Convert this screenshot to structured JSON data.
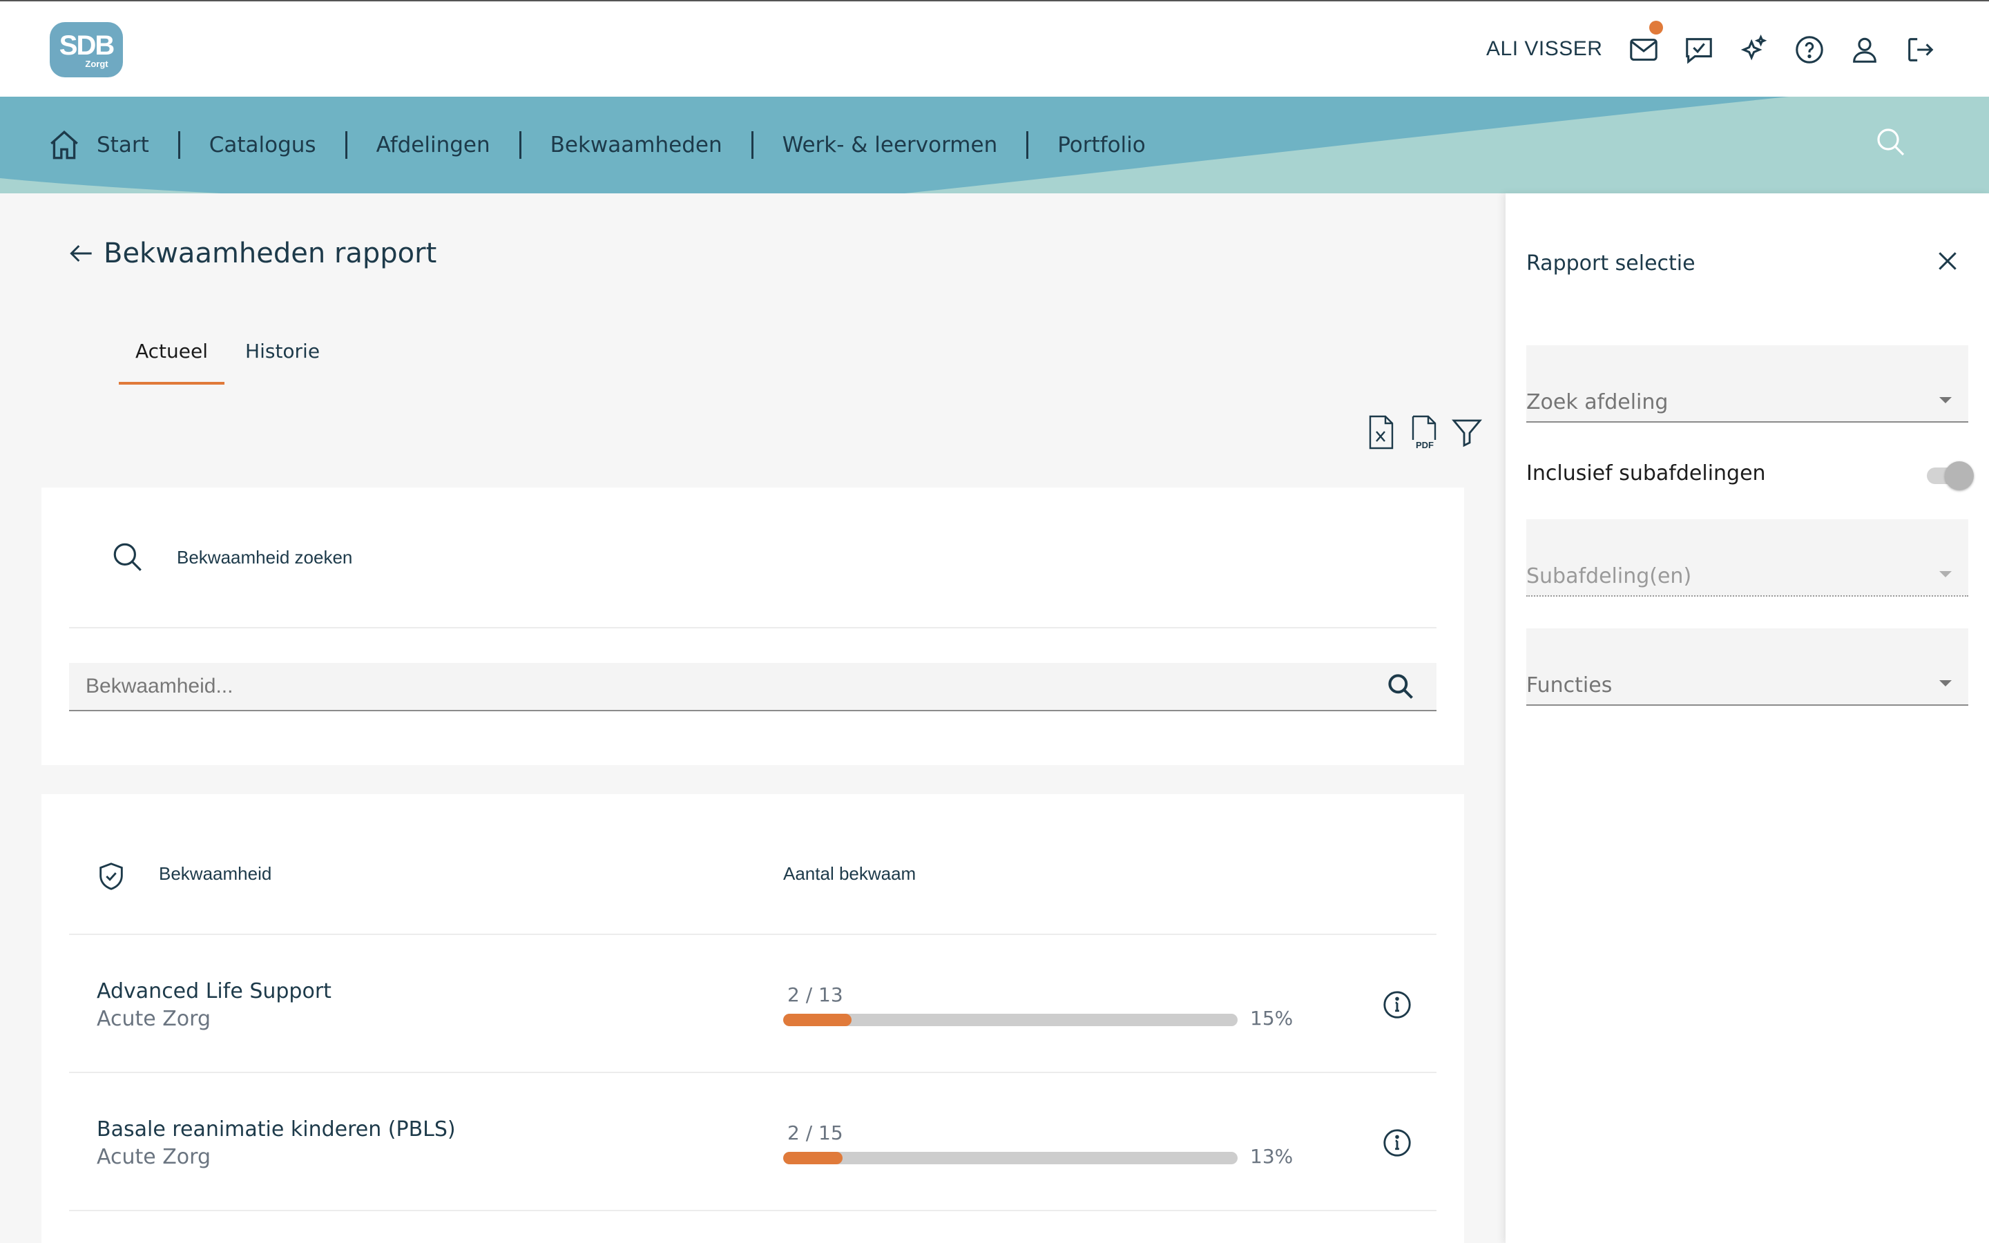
{
  "header": {
    "logo_text": "SDB",
    "logo_sub": "Zorgt",
    "user_name": "ALI VISSER",
    "icons": [
      "mail-icon",
      "chat-check-icon",
      "stars-icon",
      "help-icon",
      "user-icon",
      "logout-icon"
    ],
    "notification_color": "#e07a3a"
  },
  "nav": {
    "items": [
      {
        "label": "Start",
        "icon": "home-icon"
      },
      {
        "label": "Catalogus"
      },
      {
        "label": "Afdelingen"
      },
      {
        "label": "Bekwaamheden"
      },
      {
        "label": "Werk- & leervormen"
      },
      {
        "label": "Portfolio"
      }
    ],
    "search_icon": "search-icon",
    "colors": {
      "band": "#6fb3c4",
      "band_light": "#a8d3d0"
    }
  },
  "page": {
    "title": "Bekwaamheden rapport",
    "tabs": [
      {
        "label": "Actueel",
        "active": true
      },
      {
        "label": "Historie",
        "active": false
      }
    ],
    "toolbar": [
      "excel-export-icon",
      "pdf-export-icon",
      "filter-icon"
    ]
  },
  "search": {
    "heading": "Bekwaamheid zoeken",
    "placeholder": "Bekwaamheid..."
  },
  "table": {
    "headers": {
      "name": "Bekwaamheid",
      "count": "Aantal bekwaam"
    },
    "rows": [
      {
        "title": "Advanced Life Support",
        "subtitle": "Acute Zorg",
        "count": "2 / 13",
        "percent": "15%",
        "fraction": 0.15
      },
      {
        "title": "Basale reanimatie kinderen (PBLS)",
        "subtitle": "Acute Zorg",
        "count": "2 / 15",
        "percent": "13%",
        "fraction": 0.13
      }
    ]
  },
  "side_panel": {
    "title": "Rapport selectie",
    "fields": {
      "afdeling": "Zoek afdeling",
      "toggle_label": "Inclusief subafdelingen",
      "subafdeling": "Subafdeling(en)",
      "functies": "Functies"
    },
    "accent": "#e07a3a"
  }
}
